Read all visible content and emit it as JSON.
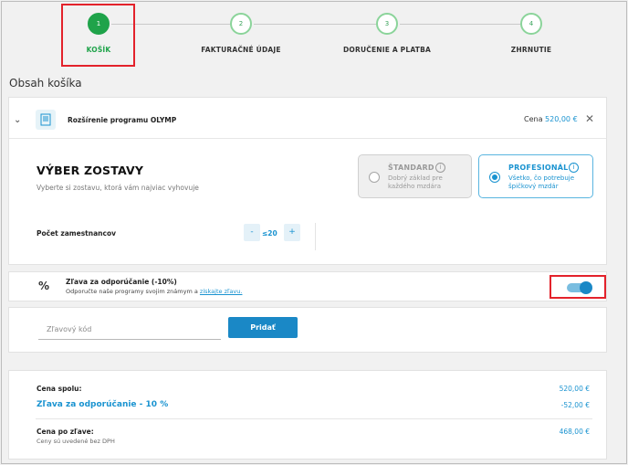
{
  "stepper": {
    "steps": [
      {
        "num": "1",
        "label": "KOŠÍK"
      },
      {
        "num": "2",
        "label": "FAKTURAČNÉ ÚDAJE"
      },
      {
        "num": "3",
        "label": "DORUČENIE A PLATBA"
      },
      {
        "num": "4",
        "label": "ZHRNUTIE"
      }
    ],
    "active_step": 1
  },
  "section_title": "Obsah košíka",
  "product": {
    "name": "Rozšírenie programu OLYMP",
    "price_label": "Cena",
    "price_value": "520,00 €",
    "icon": "document-icon",
    "expand_icon": "chevron-down-icon",
    "remove_icon": "close-icon"
  },
  "config": {
    "title": "VÝBER ZOSTAVY",
    "subtitle": "Vyberte si zostavu, ktorá vám najviac vyhovuje",
    "options": [
      {
        "title": "ŠTANDARD",
        "desc": "Dobrý základ pre každého mzdára",
        "selected": false
      },
      {
        "title": "PROFESIONÁL",
        "desc": "Všetko, čo potrebuje špičkový mzdár",
        "selected": true
      }
    ],
    "info_icon": "i"
  },
  "employees": {
    "label": "Počet zamestnancov",
    "minus": "-",
    "value": "≤20",
    "plus": "+"
  },
  "referral": {
    "icon_text": "%",
    "title": "Zľava za odporúčanie (-10%)",
    "subtitle_prefix": "Odporučte naše programy svojim známym a",
    "link_text": "získajte zľavu.",
    "toggle_on": true
  },
  "coupon": {
    "placeholder": "Zľavový kód",
    "button": "Pridať"
  },
  "summary": {
    "total_label": "Cena spolu:",
    "total_value": "520,00 €",
    "discount_label": "Zľava za odporúčanie - 10 %",
    "discount_value": "-52,00 €",
    "after_label": "Cena po zľave:",
    "after_note": "Ceny sú uvedené bez DPH",
    "after_value": "468,00 €"
  },
  "colors": {
    "accent_blue": "#1a93d0",
    "active_green": "#1fa34a",
    "highlight_red": "#e3222b"
  }
}
